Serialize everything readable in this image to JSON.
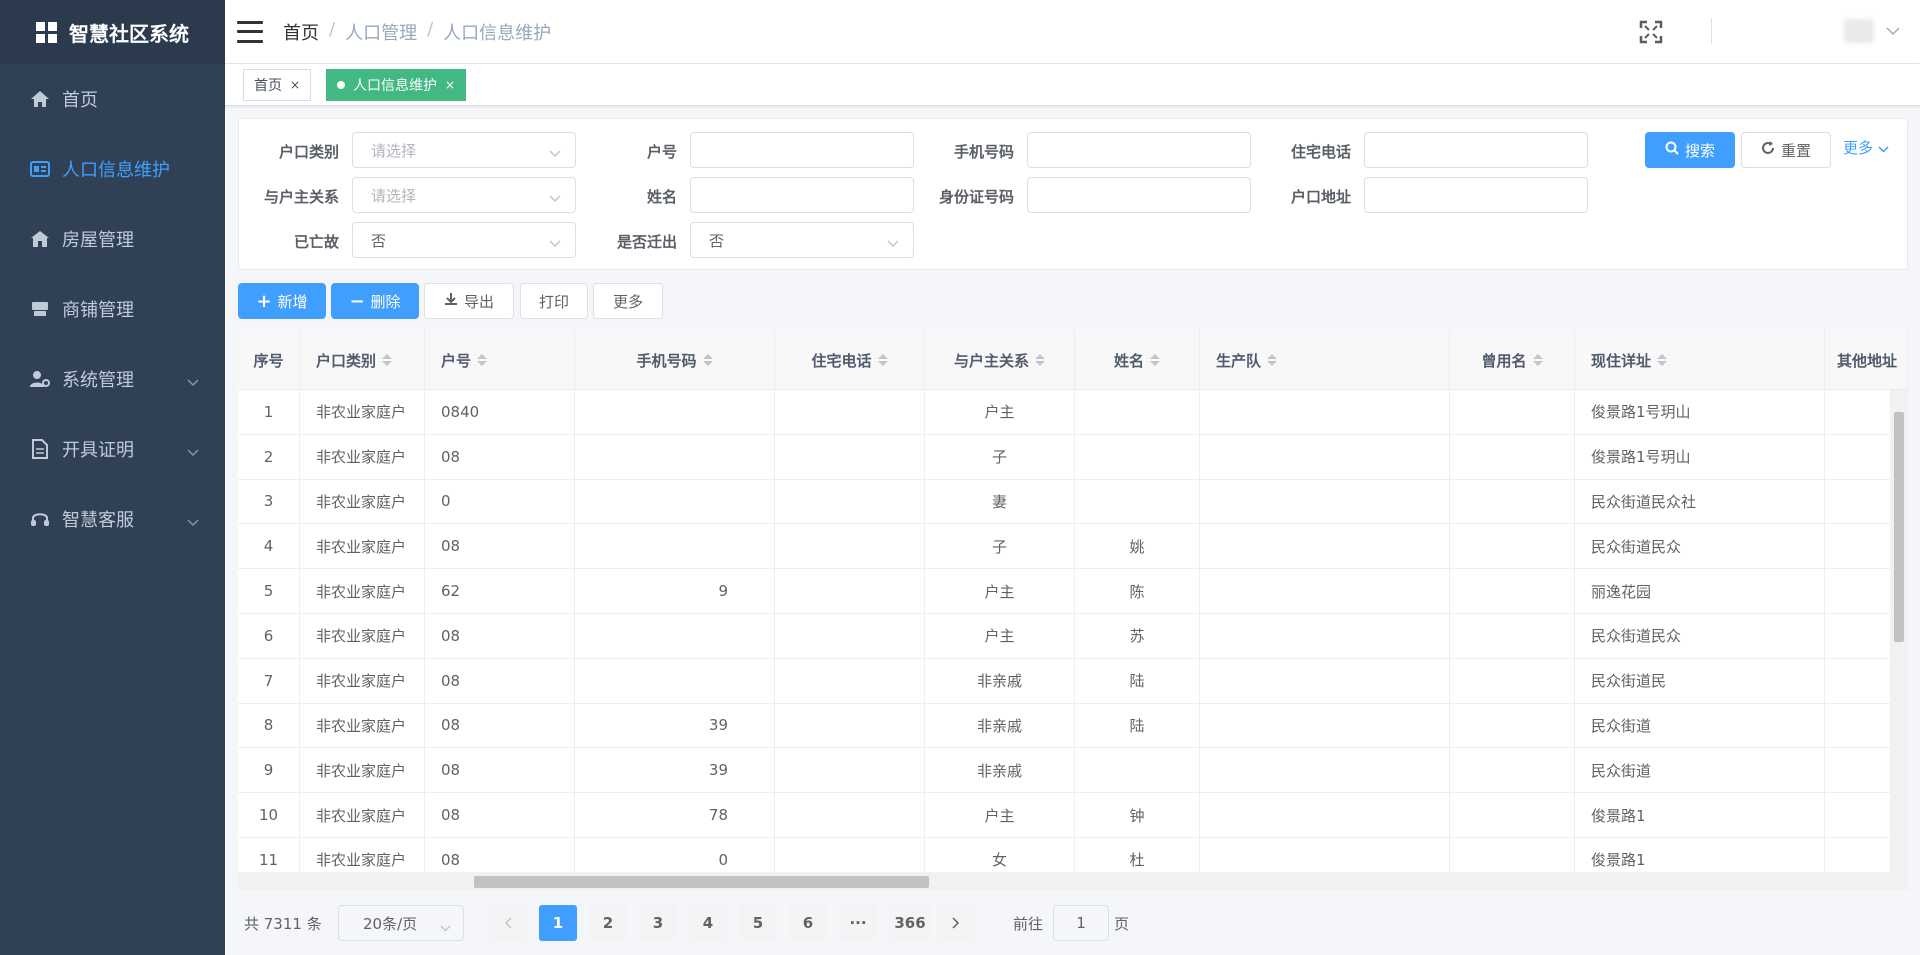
{
  "app": {
    "title": "智慧社区系统"
  },
  "sidebar": {
    "items": [
      {
        "label": "首页",
        "icon": "home-icon"
      },
      {
        "label": "人口信息维护",
        "icon": "id-card-icon",
        "active": true
      },
      {
        "label": "房屋管理",
        "icon": "house-icon"
      },
      {
        "label": "商铺管理",
        "icon": "shop-icon"
      },
      {
        "label": "系统管理",
        "icon": "user-gear-icon",
        "expandable": true
      },
      {
        "label": "开具证明",
        "icon": "document-icon",
        "expandable": true
      },
      {
        "label": "智慧客服",
        "icon": "headset-icon",
        "expandable": true
      }
    ]
  },
  "breadcrumb": {
    "items": [
      "首页",
      "人口管理",
      "人口信息维护"
    ]
  },
  "tags": [
    {
      "label": "首页",
      "close": "×"
    },
    {
      "label": "人口信息维护",
      "close": "×",
      "active": true
    }
  ],
  "filter": {
    "labels": {
      "hukou_type": "户口类别",
      "hukou_no": "户号",
      "mobile": "手机号码",
      "home_phone": "住宅电话",
      "relation": "与户主关系",
      "name": "姓名",
      "id_no": "身份证号码",
      "address": "户口地址",
      "deceased": "已亡故",
      "moved_out": "是否迁出"
    },
    "placeholder": "请选择",
    "deceased_value": "否",
    "moved_out_value": "否",
    "search_label": "搜索",
    "reset_label": "重置",
    "more_label": "更多"
  },
  "toolbar": {
    "add": "新增",
    "delete": "删除",
    "export": "导出",
    "print": "打印",
    "more": "更多"
  },
  "table": {
    "columns": [
      "序号",
      "户口类别",
      "户号",
      "手机号码",
      "住宅电话",
      "与户主关系",
      "姓名",
      "生产队",
      "曾用名",
      "现住详址",
      "其他地址"
    ],
    "rows": [
      {
        "no": "1",
        "type": "非农业家庭户",
        "hukou": "0840",
        "mobile": "",
        "phone": "",
        "relation": "户主",
        "name": "",
        "team": "",
        "former": "",
        "addr": "俊景路1号玥山"
      },
      {
        "no": "2",
        "type": "非农业家庭户",
        "hukou": "08",
        "mobile": "",
        "phone": "",
        "relation": "子",
        "name": "",
        "team": "",
        "former": "",
        "addr": "俊景路1号玥山"
      },
      {
        "no": "3",
        "type": "非农业家庭户",
        "hukou": "0",
        "mobile": "",
        "phone": "",
        "relation": "妻",
        "name": "",
        "team": "",
        "former": "",
        "addr": "民众街道民众社"
      },
      {
        "no": "4",
        "type": "非农业家庭户",
        "hukou": "08",
        "mobile": "",
        "phone": "",
        "relation": "子",
        "name": "姚",
        "team": "",
        "former": "",
        "addr": "民众街道民众"
      },
      {
        "no": "5",
        "type": "非农业家庭户",
        "hukou": "62",
        "mobile": "9",
        "phone": "",
        "relation": "户主",
        "name": "陈",
        "team": "",
        "former": "",
        "addr": "丽逸花园"
      },
      {
        "no": "6",
        "type": "非农业家庭户",
        "hukou": "08",
        "mobile": "",
        "phone": "",
        "relation": "户主",
        "name": "苏",
        "team": "",
        "former": "",
        "addr": "民众街道民众"
      },
      {
        "no": "7",
        "type": "非农业家庭户",
        "hukou": "08",
        "mobile": "",
        "phone": "",
        "relation": "非亲戚",
        "name": "陆",
        "team": "",
        "former": "",
        "addr": "民众街道民"
      },
      {
        "no": "8",
        "type": "非农业家庭户",
        "hukou": "08",
        "mobile": "39",
        "phone": "",
        "relation": "非亲戚",
        "name": "陆",
        "team": "",
        "former": "",
        "addr": "民众街道"
      },
      {
        "no": "9",
        "type": "非农业家庭户",
        "hukou": "08",
        "mobile": "39",
        "phone": "",
        "relation": "非亲戚",
        "name": "",
        "team": "",
        "former": "",
        "addr": "民众街道"
      },
      {
        "no": "10",
        "type": "非农业家庭户",
        "hukou": "08",
        "mobile": "78",
        "phone": "",
        "relation": "户主",
        "name": "钟",
        "team": "",
        "former": "",
        "addr": "俊景路1"
      },
      {
        "no": "11",
        "type": "非农业家庭户",
        "hukou": "08",
        "mobile": "0",
        "phone": "",
        "relation": "女",
        "name": "杜",
        "team": "",
        "former": "",
        "addr": "俊景路1"
      }
    ]
  },
  "pagination": {
    "total": "共 7311 条",
    "page_size": "20条/页",
    "pages": [
      "1",
      "2",
      "3",
      "4",
      "5",
      "6",
      "···",
      "366"
    ],
    "current": "1",
    "goto_label": "前往",
    "goto_value": "1",
    "page_suffix": "页"
  },
  "colors": {
    "sidebar": "#304156",
    "active": "#409eff",
    "tag_active": "#42b983"
  }
}
